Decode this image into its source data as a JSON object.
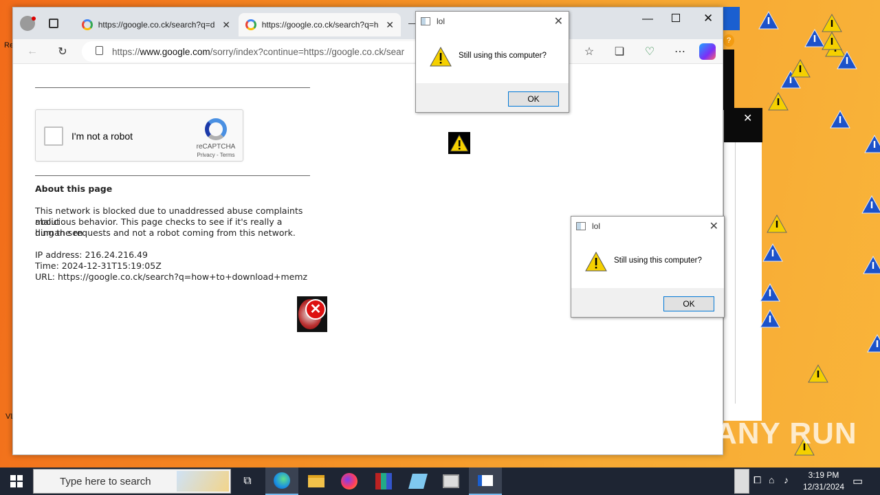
{
  "browser": {
    "tabs": [
      {
        "title": "https://google.co.ck/search?q=d",
        "active": false
      },
      {
        "title": "https://google.co.ck/search?q=h",
        "active": true
      }
    ],
    "address": {
      "prefix": "https://",
      "domain": "www.google.com",
      "rest": "/sorry/index?continue=https://google.co.ck/sear"
    }
  },
  "captcha": {
    "label": "I'm not a robot",
    "brand": "reCAPTCHA",
    "links": "Privacy - Terms"
  },
  "page": {
    "heading": "About this page",
    "paragraph_lines": [
      "This network is blocked due to unaddressed abuse complaints about",
      "malicious behavior. This page checks to see if it's really a human sen",
      "ding the requests and not a robot coming from this network."
    ],
    "ip": "IP address: 216.24.216.49",
    "time": "Time: 2024-12-31T15:19:05Z",
    "url": "URL: https://google.co.ck/search?q=how+to+download+memz"
  },
  "dialogs": [
    {
      "title": "lol",
      "message": "Still using this computer?",
      "button": "OK"
    },
    {
      "title": "lol",
      "message": "Still using this computer?",
      "button": "OK"
    }
  ],
  "taskbar": {
    "search_placeholder": "Type here to search",
    "time": "3:19 PM",
    "date": "12/31/2024"
  },
  "desktop_edge_text": {
    "re": "Re",
    "vl": "VL"
  },
  "watermark": "ANY RUN",
  "colors": {
    "warning_yellow": "#f5d000",
    "warning_blue": "#1c52c9",
    "taskbar": "#1e2533",
    "accent": "#0078d7"
  }
}
